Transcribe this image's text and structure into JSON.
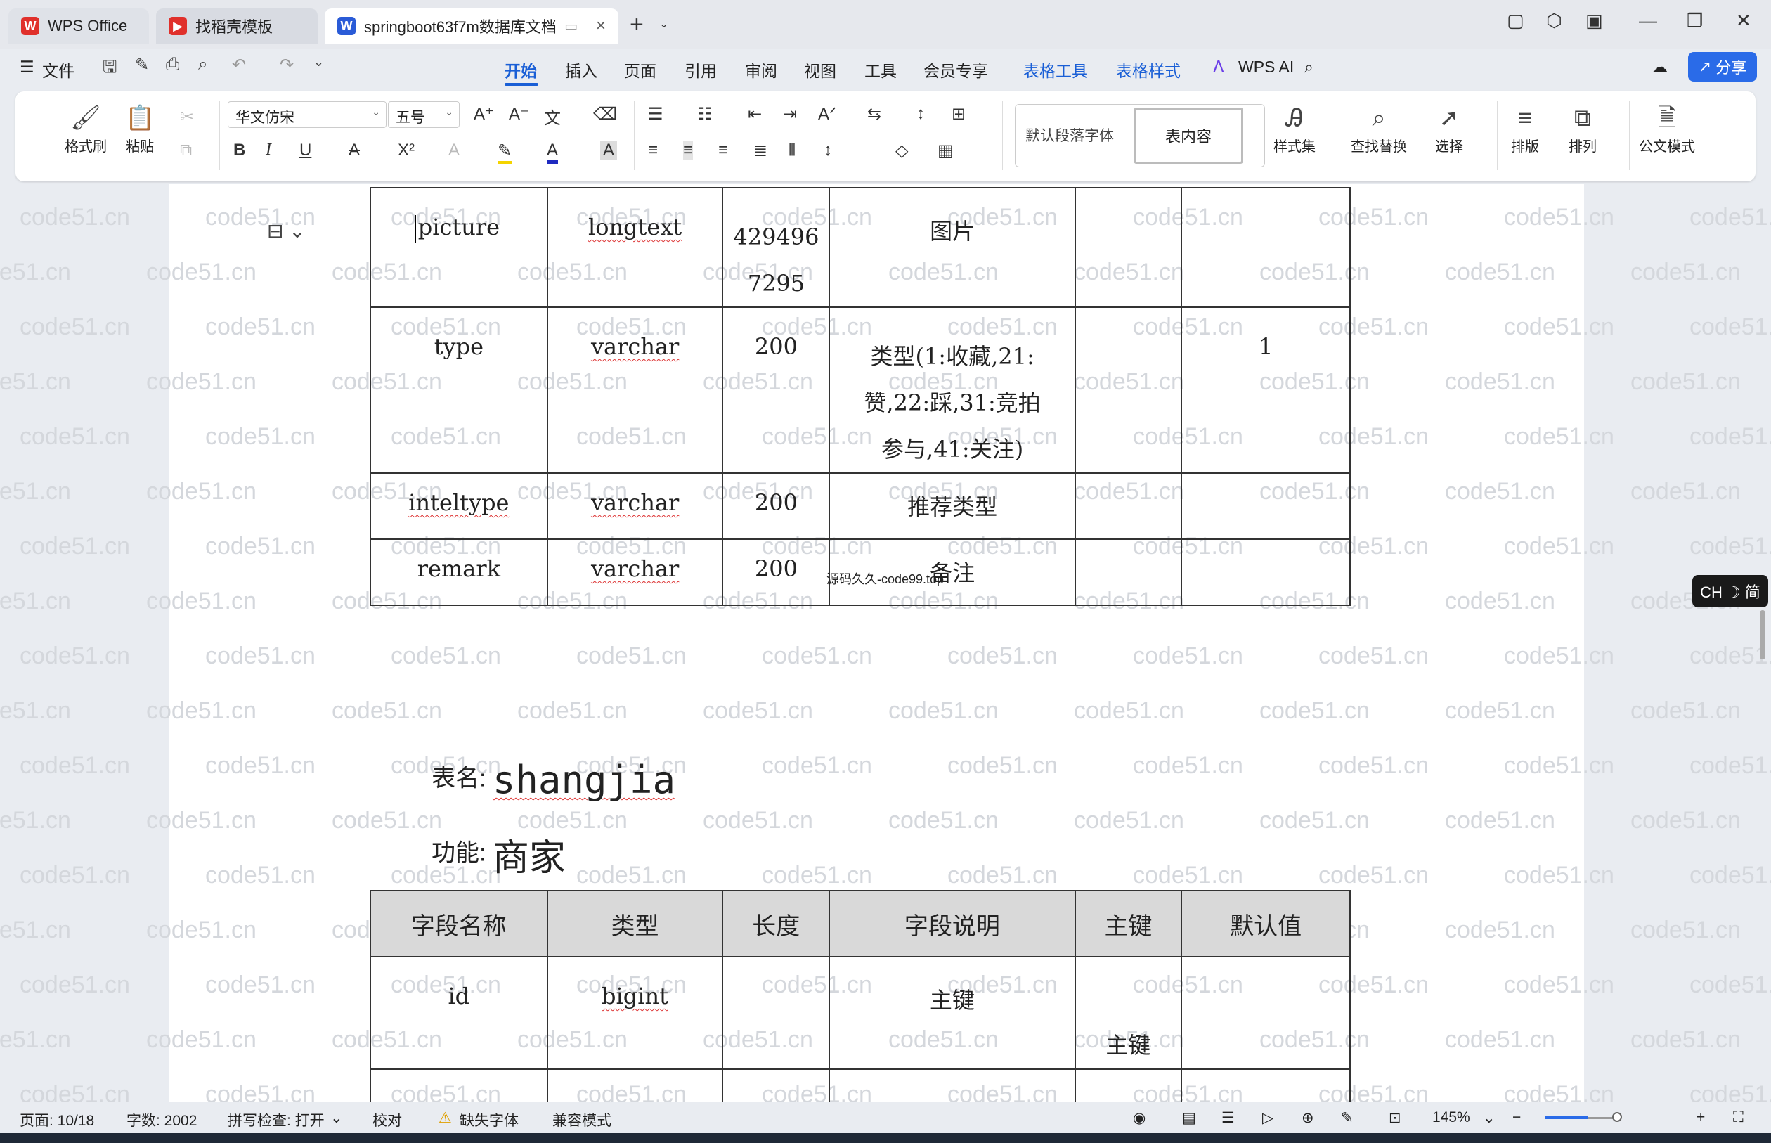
{
  "titlebar": {
    "tabs": [
      {
        "label": "WPS Office",
        "icon": "wps-logo-icon"
      },
      {
        "label": "找稻壳模板",
        "icon": "daoke-icon"
      },
      {
        "label": "springboot63f7m数据库文档",
        "icon": "word-doc-icon"
      }
    ]
  },
  "menu": {
    "file": "文件",
    "items": [
      "开始",
      "插入",
      "页面",
      "引用",
      "审阅",
      "视图",
      "工具",
      "会员专享",
      "表格工具",
      "表格样式"
    ],
    "wps_ai": "WPS AI",
    "share": "分享"
  },
  "ribbon": {
    "format_painter": "格式刷",
    "paste": "粘贴",
    "font_name": "华文仿宋",
    "font_size": "五号",
    "style_normal": "默认段落字体",
    "style_table": "表内容",
    "style_set": "样式集",
    "find_replace": "查找替换",
    "select": "选择",
    "typeset": "排版",
    "arrange": "排列",
    "official_mode": "公文模式"
  },
  "doc": {
    "table1": {
      "rows": [
        {
          "name": "picture",
          "type": "longtext",
          "length_a": "429496",
          "length_b": "7295",
          "desc": "图片",
          "pk": "",
          "default": ""
        },
        {
          "name": "type",
          "type": "varchar",
          "length_a": "200",
          "length_b": "",
          "desc_lines": [
            "类型(1:收藏,21:",
            "赞,22:踩,31:竞拍",
            "参与,41:关注)"
          ],
          "pk": "",
          "default": "1"
        },
        {
          "name": "inteltype",
          "type": "varchar",
          "length_a": "200",
          "desc": "推荐类型",
          "pk": "",
          "default": ""
        },
        {
          "name": "remark",
          "type": "varchar",
          "length_a": "200",
          "desc": "备注",
          "pk": "",
          "default": ""
        }
      ]
    },
    "inline_watermark": "源码久久-code99.top",
    "table_name_label": "表名:",
    "table_name": "shangjia",
    "function_label": "功能:",
    "function": "商家",
    "table2": {
      "headers": [
        "字段名称",
        "类型",
        "长度",
        "字段说明",
        "主键",
        "默认值"
      ],
      "rows": [
        {
          "name": "id",
          "type": "bigint",
          "length": "",
          "desc": "主键",
          "pk": "主键",
          "default": ""
        }
      ]
    },
    "watermark": "code51.cn"
  },
  "ime": "CH ☽ 简",
  "status": {
    "page": "页面: 10/18",
    "words": "字数: 2002",
    "spell": "拼写检查: 打开",
    "proof": "校对",
    "missing_font": "缺失字体",
    "compat": "兼容模式",
    "zoom": "145%"
  },
  "colors": {
    "accent": "#1a5fd6",
    "share_bg": "#2a6be8",
    "header_fill": "#d9d9d9"
  }
}
